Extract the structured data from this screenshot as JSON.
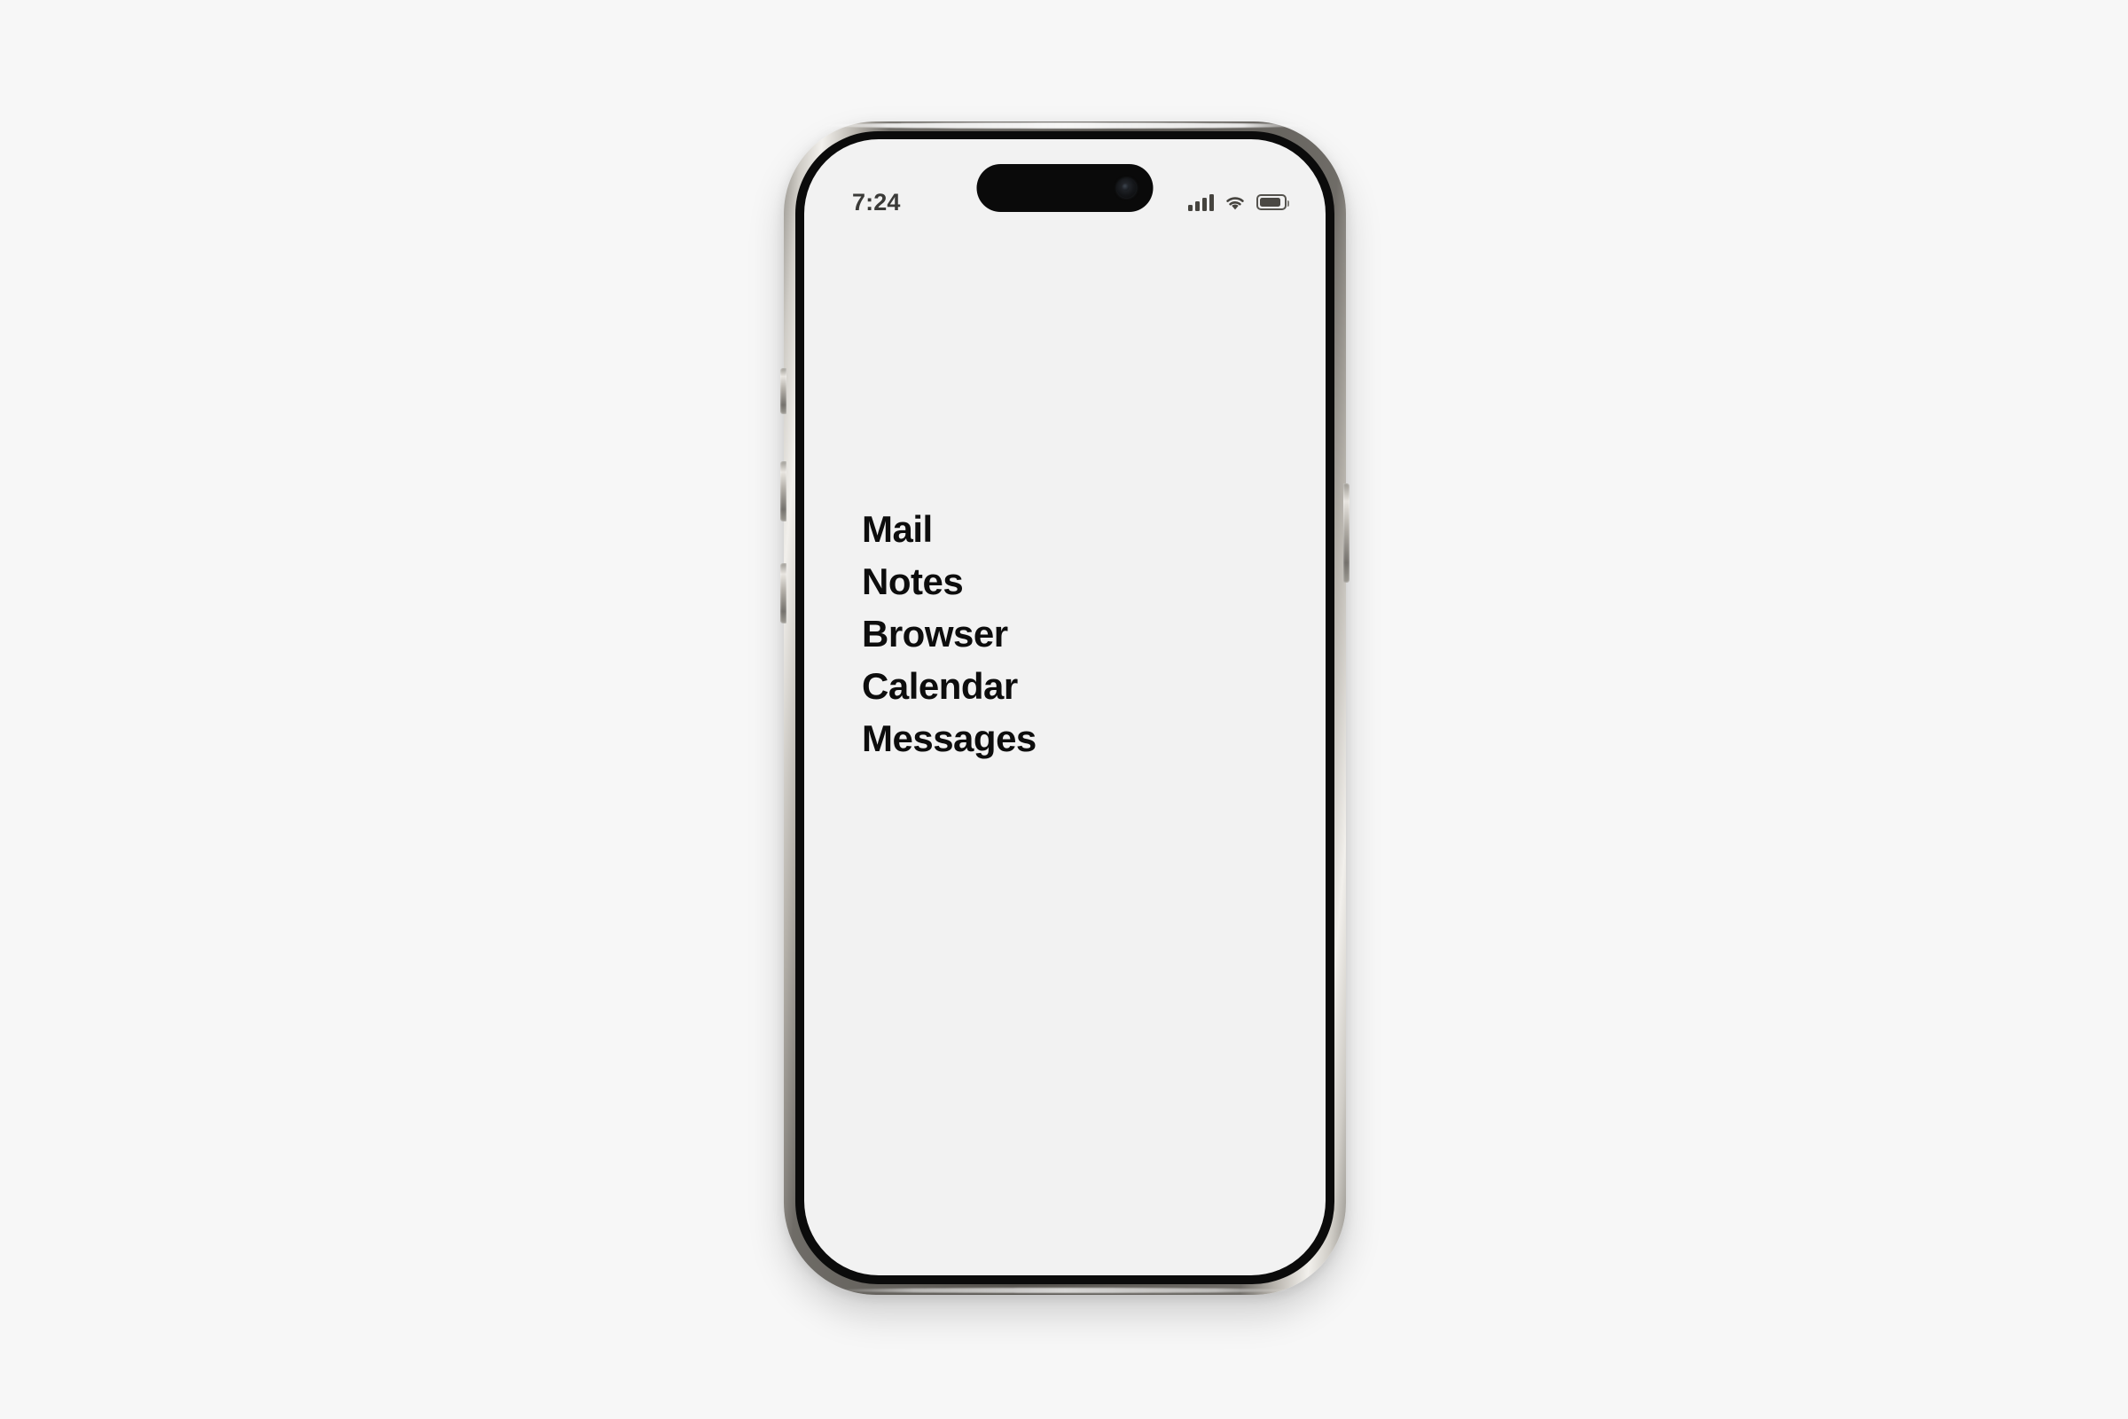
{
  "page": {
    "background_color": "#f7f7f7"
  },
  "device": {
    "name": "iphone-mockup",
    "frame_color": "#57544f",
    "bezel_color": "#0b0b0b",
    "screen_background": "#f2f2f2",
    "buttons": [
      {
        "name": "action-button",
        "side": "left"
      },
      {
        "name": "volume-up-button",
        "side": "left"
      },
      {
        "name": "volume-down-button",
        "side": "left"
      },
      {
        "name": "power-button",
        "side": "right"
      }
    ]
  },
  "status_bar": {
    "time": "7:24",
    "time_color": "#3a3a38",
    "icons": {
      "cellular": "signal-bars-icon",
      "cellular_bars": 4,
      "wifi": "wifi-icon",
      "battery": "battery-icon",
      "battery_level_percent": 78
    },
    "dynamic_island": {
      "name": "dynamic-island",
      "camera": "front-camera-lens-icon"
    }
  },
  "screen": {
    "app_list": {
      "title": "",
      "items": [
        {
          "label": "Mail"
        },
        {
          "label": "Notes"
        },
        {
          "label": "Browser"
        },
        {
          "label": "Calendar"
        },
        {
          "label": "Messages"
        }
      ]
    }
  }
}
